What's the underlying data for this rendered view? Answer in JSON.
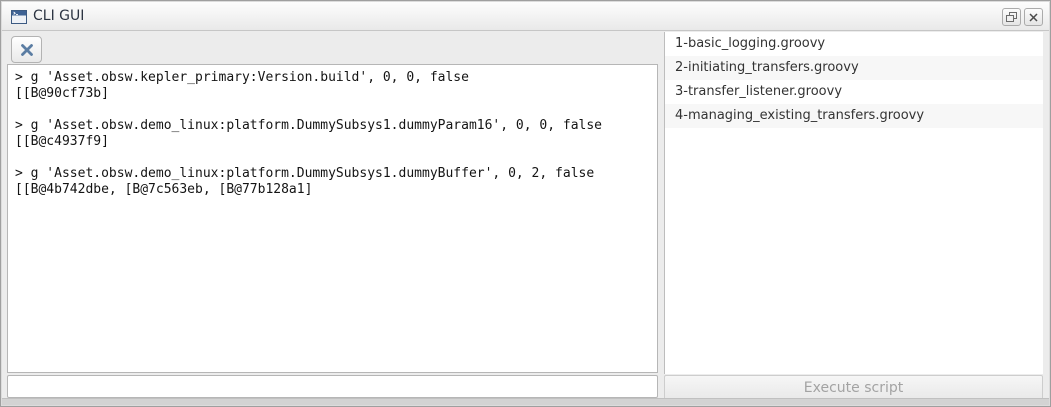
{
  "window": {
    "title": "CLI GUI",
    "titlebar_icon": "terminal-window-icon",
    "float_button_icon": "float-window-icon",
    "close_button_icon": "close-icon"
  },
  "colors": {
    "accent_blue": "#5b7da3",
    "title_text": "#2c3442",
    "disabled_text": "#a3a3a3",
    "row_alternate": "#f7f7f7"
  },
  "left_panel": {
    "toolbar": {
      "clear_icon": "x-clear-icon"
    },
    "console": {
      "text": "> g 'Asset.obsw.kepler_primary:Version.build', 0, 0, false\n[[B@90cf73b]\n\n> g 'Asset.obsw.demo_linux:platform.DummySubsys1.dummyParam16', 0, 0, false\n[[B@c4937f9]\n\n> g 'Asset.obsw.demo_linux:platform.DummySubsys1.dummyBuffer', 0, 2, false\n[[B@4b742dbe, [B@7c563eb, [B@77b128a1]"
    },
    "input": {
      "value": "",
      "placeholder": ""
    }
  },
  "right_panel": {
    "scripts": [
      "1-basic_logging.groovy",
      "2-initiating_transfers.groovy",
      "3-transfer_listener.groovy",
      "4-managing_existing_transfers.groovy"
    ],
    "execute_button": {
      "label": "Execute script",
      "enabled": false
    }
  }
}
